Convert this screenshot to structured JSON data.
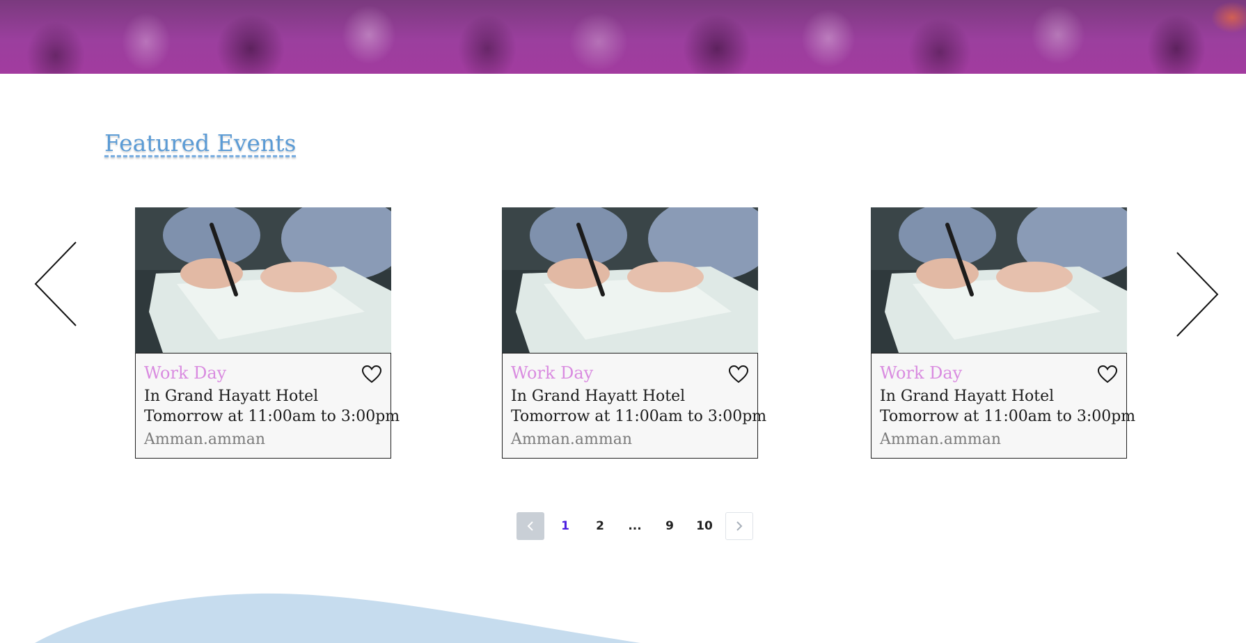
{
  "section": {
    "title": "Featured Events"
  },
  "carousel": {
    "prev_icon": "chevron-left-icon",
    "next_icon": "chevron-right-icon"
  },
  "events": [
    {
      "title": "Work Day",
      "venue": "In Grand Hayatt Hotel",
      "time": "Tomorrow at 11:00am to 3:00pm",
      "location": "Amman.amman",
      "favorite_icon": "heart-icon"
    },
    {
      "title": "Work Day",
      "venue": "In Grand Hayatt Hotel",
      "time": "Tomorrow at 11:00am to 3:00pm",
      "location": "Amman.amman",
      "favorite_icon": "heart-icon"
    },
    {
      "title": "Work Day",
      "venue": "In Grand Hayatt Hotel",
      "time": "Tomorrow at 11:00am to 3:00pm",
      "location": "Amman.amman",
      "favorite_icon": "heart-icon"
    }
  ],
  "pagination": {
    "prev_icon": "chevron-left-icon",
    "next_icon": "chevron-right-icon",
    "pages": [
      "1",
      "2",
      "...",
      "9",
      "10"
    ],
    "current": "1"
  },
  "colors": {
    "accent_title": "#5b9bd5",
    "event_title": "#d98be0",
    "active_page": "#4b1ee0",
    "hero_tint": "#9b3f9e",
    "wave": "#c6dcee"
  }
}
